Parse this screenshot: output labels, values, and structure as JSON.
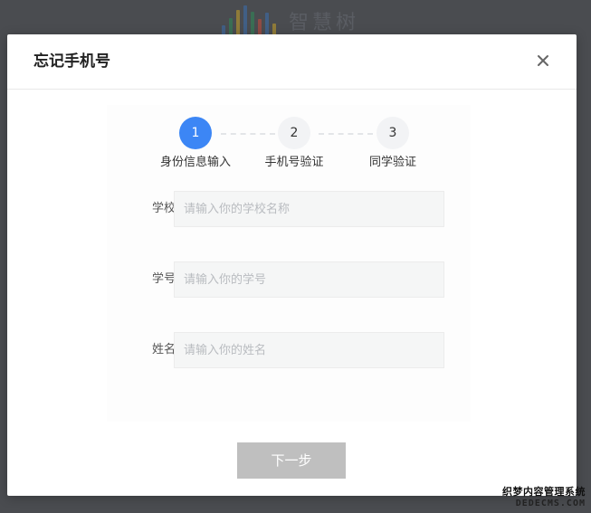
{
  "background": {
    "logo_text": "智慧树",
    "logo_bar_colors": [
      "#3a6fb0",
      "#2e8b57",
      "#c9a227",
      "#3a6fb0",
      "#2e8b57",
      "#c94a3a",
      "#3a6fb0",
      "#c9a227"
    ],
    "logo_bar_heights": [
      0.35,
      0.6,
      0.85,
      1.0,
      0.8,
      0.55,
      0.75,
      0.4
    ]
  },
  "modal": {
    "title": "忘记手机号",
    "close_icon": "close-icon"
  },
  "steps": [
    {
      "number": "1",
      "label": "身份信息输入",
      "state": "active"
    },
    {
      "number": "2",
      "label": "手机号验证",
      "state": "inactive"
    },
    {
      "number": "3",
      "label": "同学验证",
      "state": "inactive"
    }
  ],
  "form": {
    "school": {
      "label": "学校",
      "value": "",
      "placeholder": "请输入你的学校名称"
    },
    "student_id": {
      "label": "学号",
      "value": "",
      "placeholder": "请输入你的学号"
    },
    "name": {
      "label": "姓名",
      "value": "",
      "placeholder": "请输入你的姓名"
    }
  },
  "actions": {
    "next_label": "下一步"
  },
  "watermark": {
    "line1": "织梦内容管理系统",
    "line2": "DEDECMS.COM"
  },
  "colors": {
    "accent": "#3c86f5",
    "button_disabled": "#bfbfbf",
    "overlay": "#4a4c50"
  }
}
